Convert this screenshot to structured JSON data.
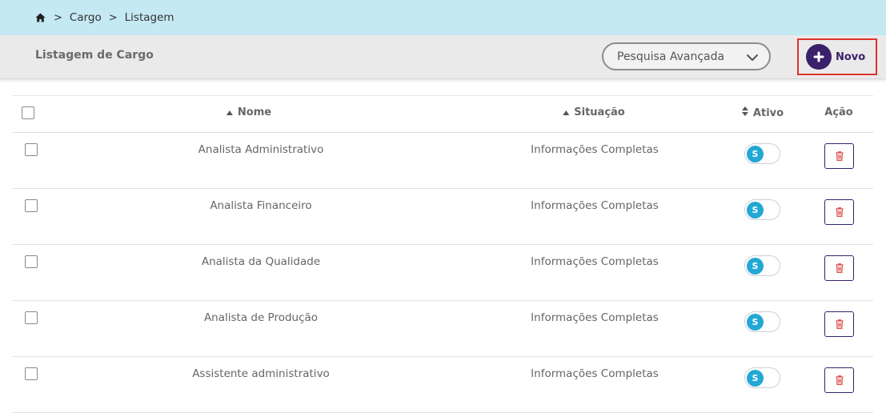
{
  "breadcrumb": {
    "home_icon": "home-icon",
    "separator": ">",
    "items": [
      "Cargo",
      "Listagem"
    ]
  },
  "header": {
    "title": "Listagem de Cargo",
    "search_label": "Pesquisa Avançada",
    "new_label": "Novo"
  },
  "table": {
    "columns": [
      "Nome",
      "Situação",
      "Ativo",
      "Ação"
    ],
    "rows": [
      {
        "nome": "Analista Administrativo",
        "situacao": "Informações Completas",
        "ativo": "S"
      },
      {
        "nome": "Analista Financeiro",
        "situacao": "Informações Completas",
        "ativo": "S"
      },
      {
        "nome": "Analista da Qualidade",
        "situacao": "Informações Completas",
        "ativo": "S"
      },
      {
        "nome": "Analista de Produção",
        "situacao": "Informações Completas",
        "ativo": "S"
      },
      {
        "nome": "Assistente administrativo",
        "situacao": "Informações Completas",
        "ativo": "S"
      }
    ]
  },
  "colors": {
    "breadcrumb_bg": "#c4e9f3",
    "header_bg": "#eaeaea",
    "primary": "#3a2169",
    "toggle_on": "#23a8d6",
    "delete_icon": "#d9534f",
    "highlight_border": "#e0322c"
  }
}
